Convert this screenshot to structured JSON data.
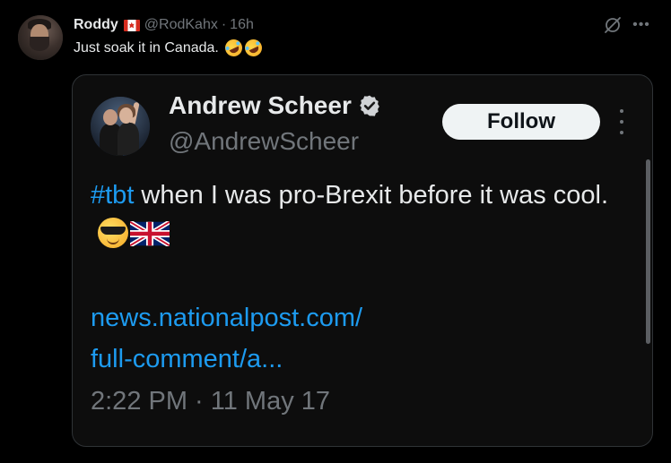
{
  "post": {
    "author_name": "Roddy",
    "author_handle": "@RodKahx",
    "separator": "·",
    "time_ago": "16h",
    "text": "Just soak it in Canada.",
    "emojis": [
      "rolling-on-floor-laughing",
      "rolling-on-floor-laughing"
    ]
  },
  "embedded": {
    "author_name": "Andrew Scheer",
    "author_handle": "@AndrewScheer",
    "verified": true,
    "follow_label": "Follow",
    "hashtag": "#tbt",
    "text_after_hashtag": " when I was pro-Brexit before it was cool.",
    "emojis": [
      "smiling-face-with-sunglasses",
      "flag-united-kingdom"
    ],
    "link_line1": "news.nationalpost.com/",
    "link_line2": "full-comment/a...",
    "timestamp": "2:22 PM · 11 May 17"
  },
  "colors": {
    "background": "#000000",
    "text": "#e7e9ea",
    "muted": "#71767b",
    "link": "#1d9bf0",
    "card_border": "#2f3336",
    "button_bg": "#eff3f4"
  }
}
